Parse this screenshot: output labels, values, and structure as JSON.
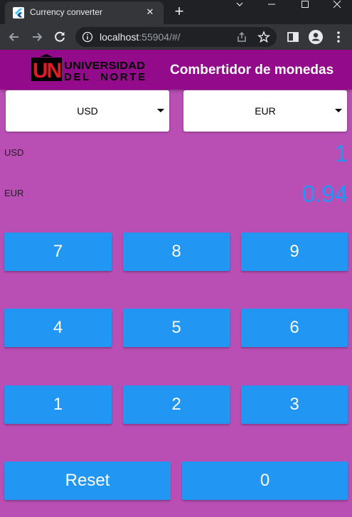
{
  "browser": {
    "tab_title": "Currency converter",
    "url_host": "localhost",
    "url_path": ":55904/#/"
  },
  "app": {
    "title": "Combertidor de monedas",
    "logo": {
      "monogram": "UN",
      "line1": "UNIVERSIDAD",
      "line2": "DEL  NORTE"
    },
    "from_currency": "USD",
    "to_currency": "EUR",
    "from_label": "USD",
    "from_amount": "1",
    "to_label": "EUR",
    "to_amount": "0.94",
    "keypad": {
      "row1": [
        "7",
        "8",
        "9"
      ],
      "row2": [
        "4",
        "5",
        "6"
      ],
      "row3": [
        "1",
        "2",
        "3"
      ],
      "reset": "Reset",
      "zero": "0"
    }
  },
  "colors": {
    "background": "#b94fb5",
    "appbar": "#930a8a",
    "accent": "#2196f3"
  }
}
